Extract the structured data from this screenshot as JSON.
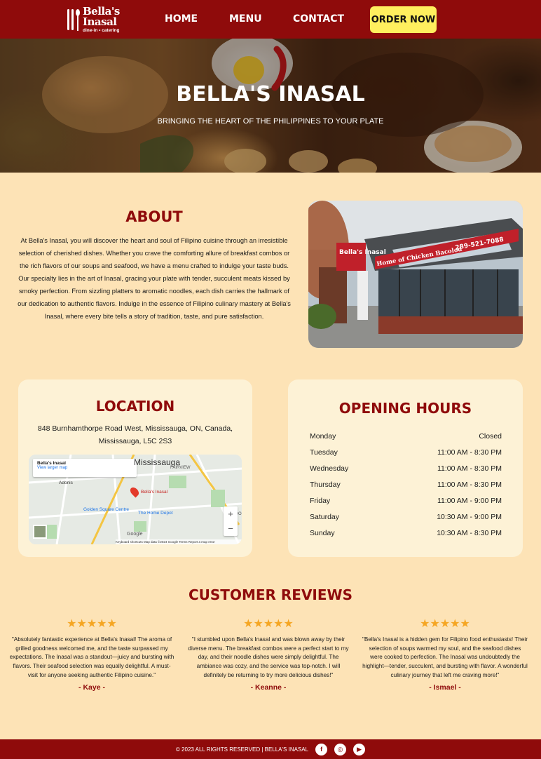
{
  "nav": {
    "logo_name_line1": "Bella's",
    "logo_name_line2": "Inasal",
    "logo_sub": "dine-in • catering",
    "links": [
      "HOME",
      "MENU",
      "CONTACT"
    ],
    "order_label": "ORDER NOW"
  },
  "hero": {
    "title": "BELLA'S INASAL",
    "subtitle": "BRINGING THE HEART OF THE PHILIPPINES TO YOUR PLATE"
  },
  "about": {
    "title": "ABOUT",
    "text": "At Bella's Inasal, you will discover the heart and soul of Filipino cuisine through an irresistible selection of cherished dishes. Whether you crave the comforting allure of breakfast combos or the rich flavors of our soups and seafood, we have a menu crafted to indulge your taste buds. Our specialty lies in the art of Inasal, gracing your plate with tender, succulent meats kissed by smoky perfection. From sizzling platters to aromatic noodles, each dish carries the hallmark of our dedication to authentic flavors. Indulge in the essence of Filipino culinary mastery at Bella's Inasal, where every bite tells a story of tradition, taste, and pure satisfaction.",
    "sign_name": "Bella's Inasal",
    "sign_text": "Home of Chicken Bacolod",
    "sign_phone": "289-521-7088"
  },
  "location": {
    "title": "LOCATION",
    "address": "848 Burnhamthorpe Road West, Mississauga, ON, Canada, Mississauga, L5C 2S3",
    "map": {
      "place_name": "Bella's Inasal",
      "larger_map_link": "View larger map",
      "city_label": "Mississauga",
      "pin_label": "Bella's Inasal",
      "labels": [
        "Adonis",
        "Golden Square Centre",
        "The Home Depot",
        "FAIRVIEW",
        "COO"
      ],
      "zoom_in": "+",
      "zoom_out": "−",
      "google": "Google",
      "footer": "Keyboard shortcuts   Map data ©2024 Google   Terms   Report a map error"
    }
  },
  "hours": {
    "title": "OPENING HOURS",
    "rows": [
      {
        "day": "Monday",
        "time": "Closed"
      },
      {
        "day": "Tuesday",
        "time": "11:00 AM - 8:30 PM"
      },
      {
        "day": "Wednesday",
        "time": "11:00 AM - 8:30 PM"
      },
      {
        "day": "Thursday",
        "time": "11:00 AM - 8:30 PM"
      },
      {
        "day": "Friday",
        "time": "11:00 AM - 9:00 PM"
      },
      {
        "day": "Saturday",
        "time": "10:30 AM - 9:00 PM"
      },
      {
        "day": "Sunday",
        "time": "10:30 AM - 8:30 PM"
      }
    ]
  },
  "reviews": {
    "title": "CUSTOMER REVIEWS",
    "items": [
      {
        "stars": "★★★★★",
        "rating": 5,
        "text": "\"Absolutely fantastic experience at Bella's Inasal! The aroma of grilled goodness welcomed me, and the taste surpassed my expectations. The Inasal was a standout—juicy and bursting with flavors. Their seafood selection was equally delightful. A must-visit for anyone seeking authentic Filipino cuisine.\"",
        "author": "- Kaye -"
      },
      {
        "stars": "★★★★★",
        "rating": 5,
        "text": "\"I stumbled upon Bella's Inasal and was blown away by their diverse menu. The breakfast combos were a perfect start to my day, and their noodle dishes were simply delightful. The ambiance was cozy, and the service was top-notch. I will definitely be returning to try more delicious dishes!\"",
        "author": "- Keanne -"
      },
      {
        "stars": "★★★★★",
        "rating": 5,
        "text": "\"Bella's Inasal is a hidden gem for Filipino food enthusiasts! Their selection of soups warmed my soul, and the seafood dishes were cooked to perfection. The Inasal was undoubtedly the highlight—tender, succulent, and bursting with flavor. A wonderful culinary journey that left me craving more!\"",
        "author": "- Ismael -"
      }
    ]
  },
  "footer": {
    "text": "© 2023 ALL RIGHTS RESERVED | BELLA'S INASAL",
    "social": [
      {
        "name": "facebook-icon",
        "glyph": "f"
      },
      {
        "name": "instagram-icon",
        "glyph": "◎"
      },
      {
        "name": "youtube-icon",
        "glyph": "▶"
      }
    ]
  },
  "colors": {
    "brand_red": "#8f0b0b",
    "page_bg": "#fde3b6",
    "card_bg": "#fdf2d6",
    "order_yellow": "#ffef5e",
    "star": "#f5a623"
  }
}
